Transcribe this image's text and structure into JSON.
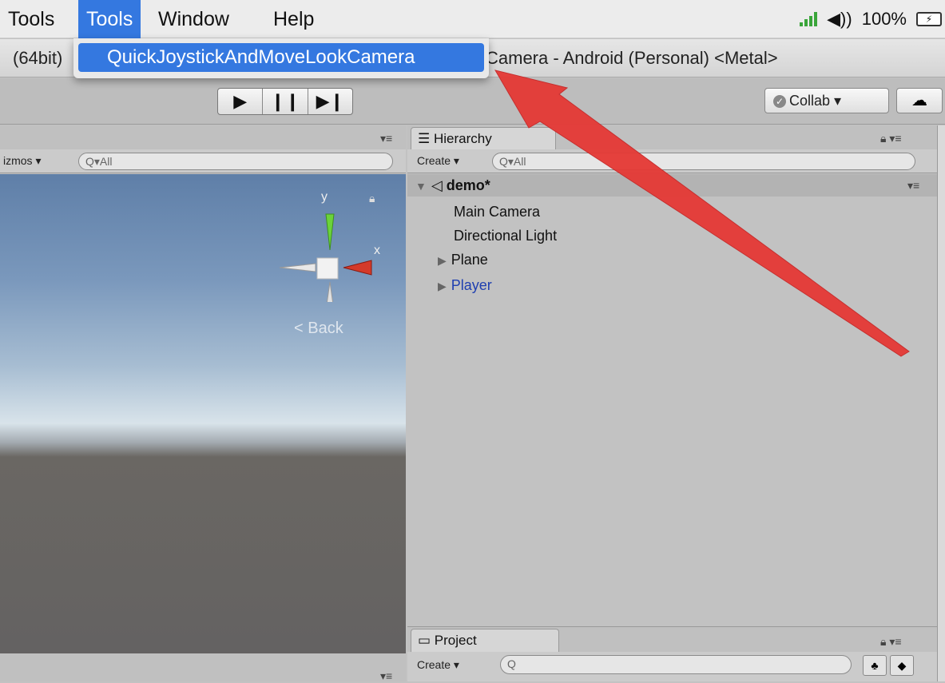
{
  "menubar": {
    "items": [
      "Tools",
      "Tools",
      "Window",
      "Help"
    ],
    "volume_text": "◀))",
    "battery_percent": "100%"
  },
  "dropdown": {
    "item_label": "QuickJoystickAndMoveLookCamera"
  },
  "titlebar": {
    "left_text": "(64bit)",
    "right_text": "Camera - Android (Personal) <Metal>"
  },
  "toolbar": {
    "collab_label": "Collab ▾"
  },
  "scene": {
    "gizmos_label": "izmos ▾",
    "search_placeholder": "Q▾All",
    "axis_y": "y",
    "axis_x": "x",
    "back_label": "< Back"
  },
  "hierarchy": {
    "tab_label": "Hierarchy",
    "create_label": "Create ▾",
    "search_placeholder": "Q▾All",
    "scene_name": "demo*",
    "items": [
      "Main Camera",
      "Directional Light",
      "Plane",
      "Player"
    ]
  },
  "project": {
    "tab_label": "Project",
    "create_label": "Create ▾",
    "search_placeholder": "Q"
  },
  "colors": {
    "menu_highlight": "#3478e0",
    "annotation_arrow": "#e53935",
    "player_text": "#1f3fb0"
  }
}
